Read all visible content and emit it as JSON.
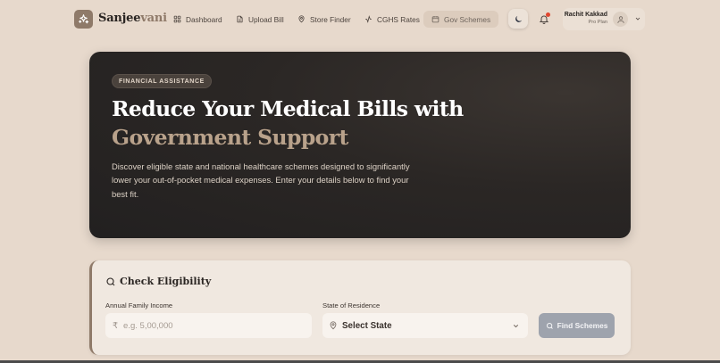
{
  "brand": {
    "name_prefix": "Sanjee",
    "name_suffix": "vani"
  },
  "nav": {
    "items": [
      {
        "label": "Dashboard",
        "icon": "grid-icon"
      },
      {
        "label": "Upload Bill",
        "icon": "file-icon"
      },
      {
        "label": "Store Finder",
        "icon": "map-pin-icon"
      },
      {
        "label": "CGHS Rates",
        "icon": "activity-icon"
      },
      {
        "label": "Gov Schemes",
        "icon": "calendar-icon",
        "active": true
      }
    ]
  },
  "user": {
    "name": "Rachit Kakkad",
    "plan": "Pro Plan"
  },
  "hero": {
    "badge": "FINANCIAL ASSISTANCE",
    "title_line1": "Reduce Your Medical Bills with",
    "title_line2": "Government Support",
    "description": "Discover eligible state and national healthcare schemes designed to significantly lower your out-of-pocket medical expenses. Enter your details below to find your best fit."
  },
  "eligibility": {
    "title": "Check Eligibility",
    "income_label": "Annual Family Income",
    "income_currency": "₹",
    "income_placeholder": "e.g. 5,00,000",
    "state_label": "State of Residence",
    "state_value": "Select State",
    "button_label": "Find Schemes"
  },
  "colors": {
    "background": "#e7d9cc",
    "accent": "#8f7a69",
    "hero_dark": "#2b2725",
    "hero_highlight": "#b9a28b",
    "button_disabled": "#9ea3ad"
  }
}
